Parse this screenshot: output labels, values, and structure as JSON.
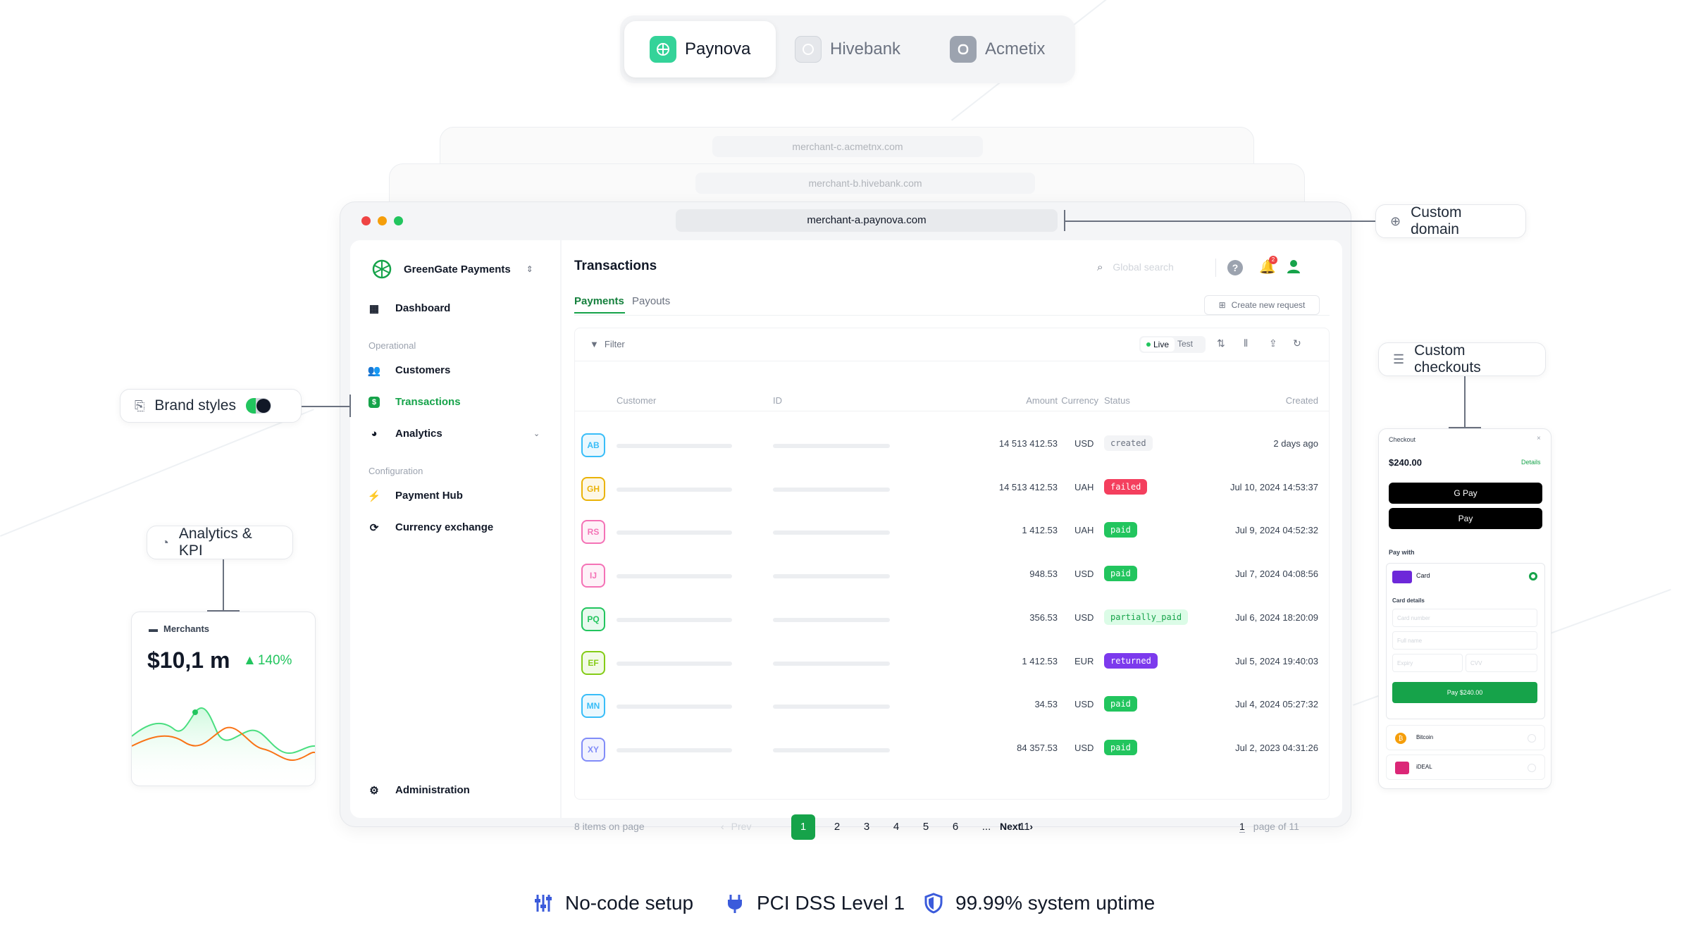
{
  "brand_switcher": {
    "brands": [
      {
        "label": "Paynova",
        "active": true
      },
      {
        "label": "Hivebank",
        "active": false
      },
      {
        "label": "Acmetix",
        "active": false
      }
    ]
  },
  "windows": {
    "ghost_c_url": "merchant-c.acmetnx.com",
    "ghost_b_url": "merchant-b.hivebank.com",
    "main_url": "merchant-a.paynova.com"
  },
  "sidebar": {
    "company": "GreenGate Payments",
    "dashboard": "Dashboard",
    "section_operational": "Operational",
    "customers": "Customers",
    "transactions": "Transactions",
    "analytics": "Analytics",
    "section_configuration": "Configuration",
    "payment_hub": "Payment Hub",
    "currency_exchange": "Currency exchange",
    "administration": "Administration"
  },
  "header": {
    "title": "Transactions",
    "search_placeholder": "Global search",
    "notification_count": "2"
  },
  "tabs": {
    "payments": "Payments",
    "payouts": "Payouts"
  },
  "toolbar": {
    "create_request": "Create new request",
    "filter": "Filter",
    "live": "Live",
    "test": "Test"
  },
  "table": {
    "headers": {
      "customer": "Customer",
      "id": "ID",
      "amount": "Amount",
      "currency": "Currency",
      "status": "Status",
      "created": "Created"
    },
    "rows": [
      {
        "initials": "AB",
        "amount": "14 513 412.53",
        "currency": "USD",
        "status": "created",
        "created": "2 days ago",
        "color": "#38bdf8"
      },
      {
        "initials": "GH",
        "amount": "14 513 412.53",
        "currency": "UAH",
        "status": "failed",
        "created": "Jul 10, 2024 14:53:37",
        "color": "#eab308"
      },
      {
        "initials": "RS",
        "amount": "1 412.53",
        "currency": "UAH",
        "status": "paid",
        "created": "Jul 9, 2024 04:52:32",
        "color": "#f472b6"
      },
      {
        "initials": "IJ",
        "amount": "948.53",
        "currency": "USD",
        "status": "paid",
        "created": "Jul 7, 2024 04:08:56",
        "color": "#f472b6"
      },
      {
        "initials": "PQ",
        "amount": "356.53",
        "currency": "USD",
        "status": "partially_paid",
        "created": "Jul 6, 2024 18:20:09",
        "color": "#22c55e"
      },
      {
        "initials": "EF",
        "amount": "1 412.53",
        "currency": "EUR",
        "status": "returned",
        "created": "Jul 5, 2024 19:40:03",
        "color": "#84cc16"
      },
      {
        "initials": "MN",
        "amount": "34.53",
        "currency": "USD",
        "status": "paid",
        "created": "Jul 4, 2024 05:27:32",
        "color": "#38bdf8"
      },
      {
        "initials": "XY",
        "amount": "84 357.53",
        "currency": "USD",
        "status": "paid",
        "created": "Jul 2, 2023 04:31:26",
        "color": "#818cf8"
      }
    ]
  },
  "pagination": {
    "items_on_page": "8 items on page",
    "prev": "Prev",
    "pages": [
      "1",
      "2",
      "3",
      "4",
      "5",
      "6",
      "...",
      "11"
    ],
    "current_page": "1",
    "next": "Next",
    "page_number": "1",
    "page_of": "page of 11"
  },
  "callouts": {
    "custom_domain": "Custom domain",
    "brand_styles": "Brand styles",
    "analytics_kpi": "Analytics & KPI",
    "custom_checkouts": "Custom checkouts"
  },
  "kpi_card": {
    "label": "Merchants",
    "value": "$10,1 m",
    "change": "140%"
  },
  "checkout": {
    "title": "Checkout",
    "amount": "$240.00",
    "details": "Details",
    "gpay": "G Pay",
    "apay": " Pay",
    "pay_with": "Pay with",
    "card": "Card",
    "card_details": "Card details",
    "card_number": "Card number",
    "full_name": "Full name",
    "expiry": "Expiry",
    "cvv": "CVV",
    "pay_button": "Pay $240.00",
    "bitcoin": "Bitcoin",
    "ideal": "iDEAL"
  },
  "footer": {
    "no_code": "No-code setup",
    "pci": "PCI DSS Level 1",
    "uptime": "99.99% system uptime"
  },
  "colors": {
    "accent": "#16a34a",
    "paynova": "#34d399",
    "footer_icons": "#3b5bdb"
  }
}
